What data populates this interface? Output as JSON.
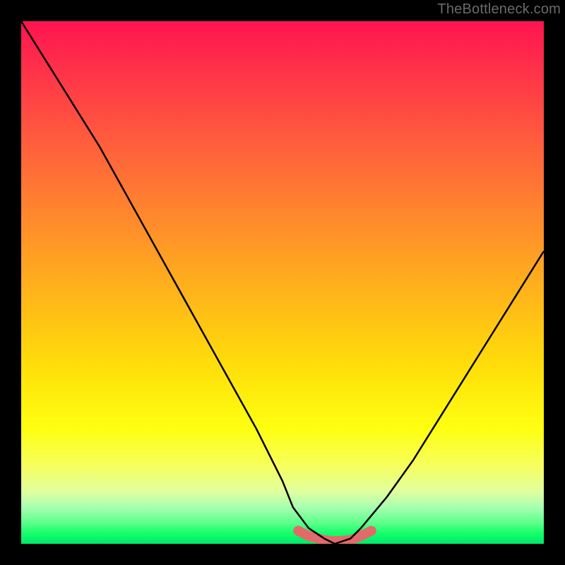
{
  "watermark": "TheBottleneck.com",
  "chart_data": {
    "type": "line",
    "title": "",
    "xlabel": "",
    "ylabel": "",
    "xlim": [
      0,
      100
    ],
    "ylim": [
      0,
      100
    ],
    "series": [
      {
        "name": "bottleneck-curve",
        "x": [
          0,
          5,
          10,
          15,
          20,
          25,
          30,
          35,
          40,
          45,
          50,
          52,
          55,
          58,
          60,
          63,
          65,
          70,
          75,
          80,
          85,
          90,
          95,
          100
        ],
        "values": [
          100,
          92,
          84,
          76,
          67,
          58,
          49,
          40,
          31,
          22,
          12,
          7,
          3,
          1,
          0,
          1,
          3,
          9,
          16,
          24,
          32,
          40,
          48,
          56
        ]
      },
      {
        "name": "highlight-segment",
        "x": [
          53,
          55,
          58,
          60,
          63,
          65,
          67
        ],
        "values": [
          2.5,
          1.5,
          0.7,
          0.5,
          0.7,
          1.5,
          2.5
        ]
      }
    ],
    "gradient_stops": [
      {
        "pos": 0,
        "color": "#ff1450"
      },
      {
        "pos": 22,
        "color": "#ff5a3e"
      },
      {
        "pos": 52,
        "color": "#ffb41a"
      },
      {
        "pos": 78,
        "color": "#feff11"
      },
      {
        "pos": 93,
        "color": "#a8ffb0"
      },
      {
        "pos": 100,
        "color": "#00e86a"
      }
    ]
  }
}
